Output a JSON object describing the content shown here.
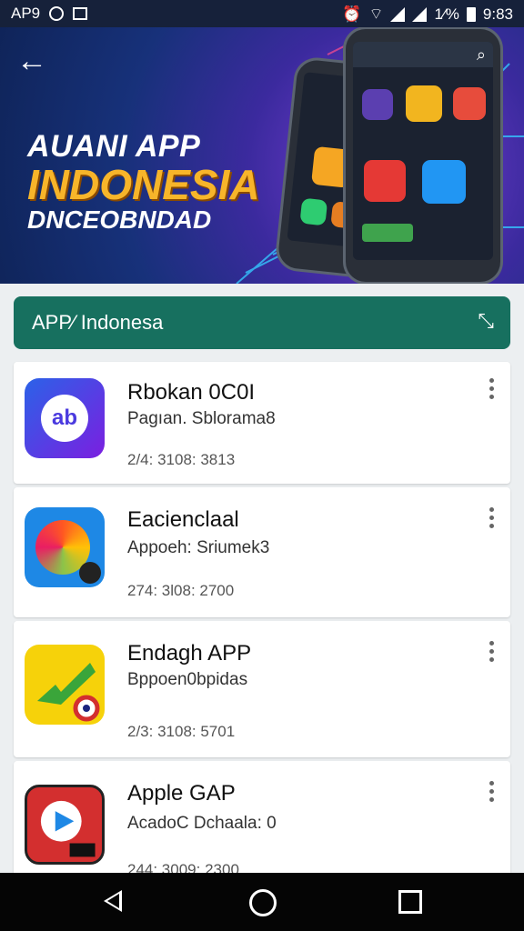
{
  "status_bar": {
    "carrier": "AP9",
    "time": "9:83",
    "battery_label": "1⁄%"
  },
  "banner": {
    "title_line1": "AUANI APP",
    "title_line2": "INDONESIA",
    "title_line3": "DNCEOBNDAD",
    "back_icon": "arrow-left-icon"
  },
  "appbar": {
    "title": "APP⁄ Indonesa",
    "tools_icon": "tools-icon"
  },
  "apps": [
    {
      "name": "Rbokan 0C0I",
      "developer": "Pagıan. Sblorama8",
      "meta": "2/4: 3108: 3813",
      "icon": "app-ab-icon"
    },
    {
      "name": "Eacienclaal",
      "developer": "Appoeh: Sriumek3",
      "meta": "274: 3l08: 2700",
      "icon": "app-fox-icon"
    },
    {
      "name": "Endagh APP",
      "developer": "Bppoen0bpidas",
      "meta": "2/3: 3108: 5701",
      "icon": "app-check-icon"
    },
    {
      "name": "Apple GAP",
      "developer": "AcadoC Dchaala: 0",
      "meta": "244: 3009: 2300",
      "icon": "app-play-icon"
    }
  ],
  "colors": {
    "appbar": "#17705f",
    "banner_title_accent": "#f7b52a",
    "status_bar": "#16213a",
    "nav_bar": "#050505"
  }
}
